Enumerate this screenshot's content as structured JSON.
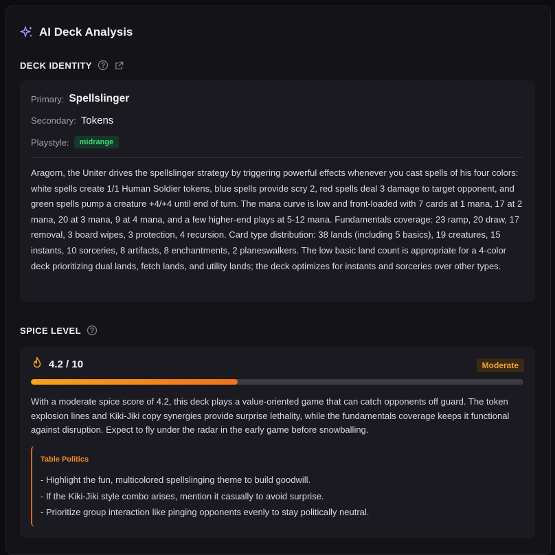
{
  "header": {
    "title": "AI Deck Analysis",
    "icon": "sparkles-icon"
  },
  "deck_identity": {
    "label": "DECK IDENTITY",
    "primary_label": "Primary:",
    "primary_value": "Spellslinger",
    "secondary_label": "Secondary:",
    "secondary_value": "Tokens",
    "playstyle_label": "Playstyle:",
    "playstyle_value": "midrange",
    "description": "Aragorn, the Uniter drives the spellslinger strategy by triggering powerful effects whenever you cast spells of his four colors: white spells create 1/1 Human Soldier tokens, blue spells provide scry 2, red spells deal 3 damage to target opponent, and green spells pump a creature +4/+4 until end of turn. The mana curve is low and front-loaded with 7 cards at 1 mana, 17 at 2 mana, 20 at 3 mana, 9 at 4 mana, and a few higher-end plays at 5-12 mana. Fundamentals coverage: 23 ramp, 20 draw, 17 removal, 3 board wipes, 3 protection, 4 recursion. Card type distribution: 38 lands (including 5 basics), 19 creatures, 15 instants, 10 sorceries, 8 artifacts, 8 enchantments, 2 planeswalkers. The low basic land count is appropriate for a 4-color deck prioritizing dual lands, fetch lands, and utility lands; the deck optimizes for instants and sorceries over other types."
  },
  "spice_level": {
    "label": "SPICE LEVEL",
    "score_text": "4.2 / 10",
    "score_value": 4.2,
    "score_max": 10,
    "badge": "Moderate",
    "description": "With a moderate spice score of 4.2, this deck plays a value-oriented game that can catch opponents off guard. The token explosion lines and Kiki-Jiki copy synergies provide surprise lethality, while the fundamentals coverage keeps it functional against disruption. Expect to fly under the radar in the early game before snowballing.",
    "table_politics": {
      "title": "Table Politics",
      "items": [
        "- Highlight the fun, multicolored spellslinging theme to build goodwill.",
        "- If the Kiki-Jiki style combo arises, mention it casually to avoid surprise.",
        "- Prioritize group interaction like pinging opponents evenly to stay politically neutral."
      ]
    }
  },
  "colors": {
    "accent_purple": "#a78bfa",
    "playstyle_green": "#3ddc72",
    "spice_orange": "#f0721d",
    "moderate_amber": "#f0a335"
  }
}
